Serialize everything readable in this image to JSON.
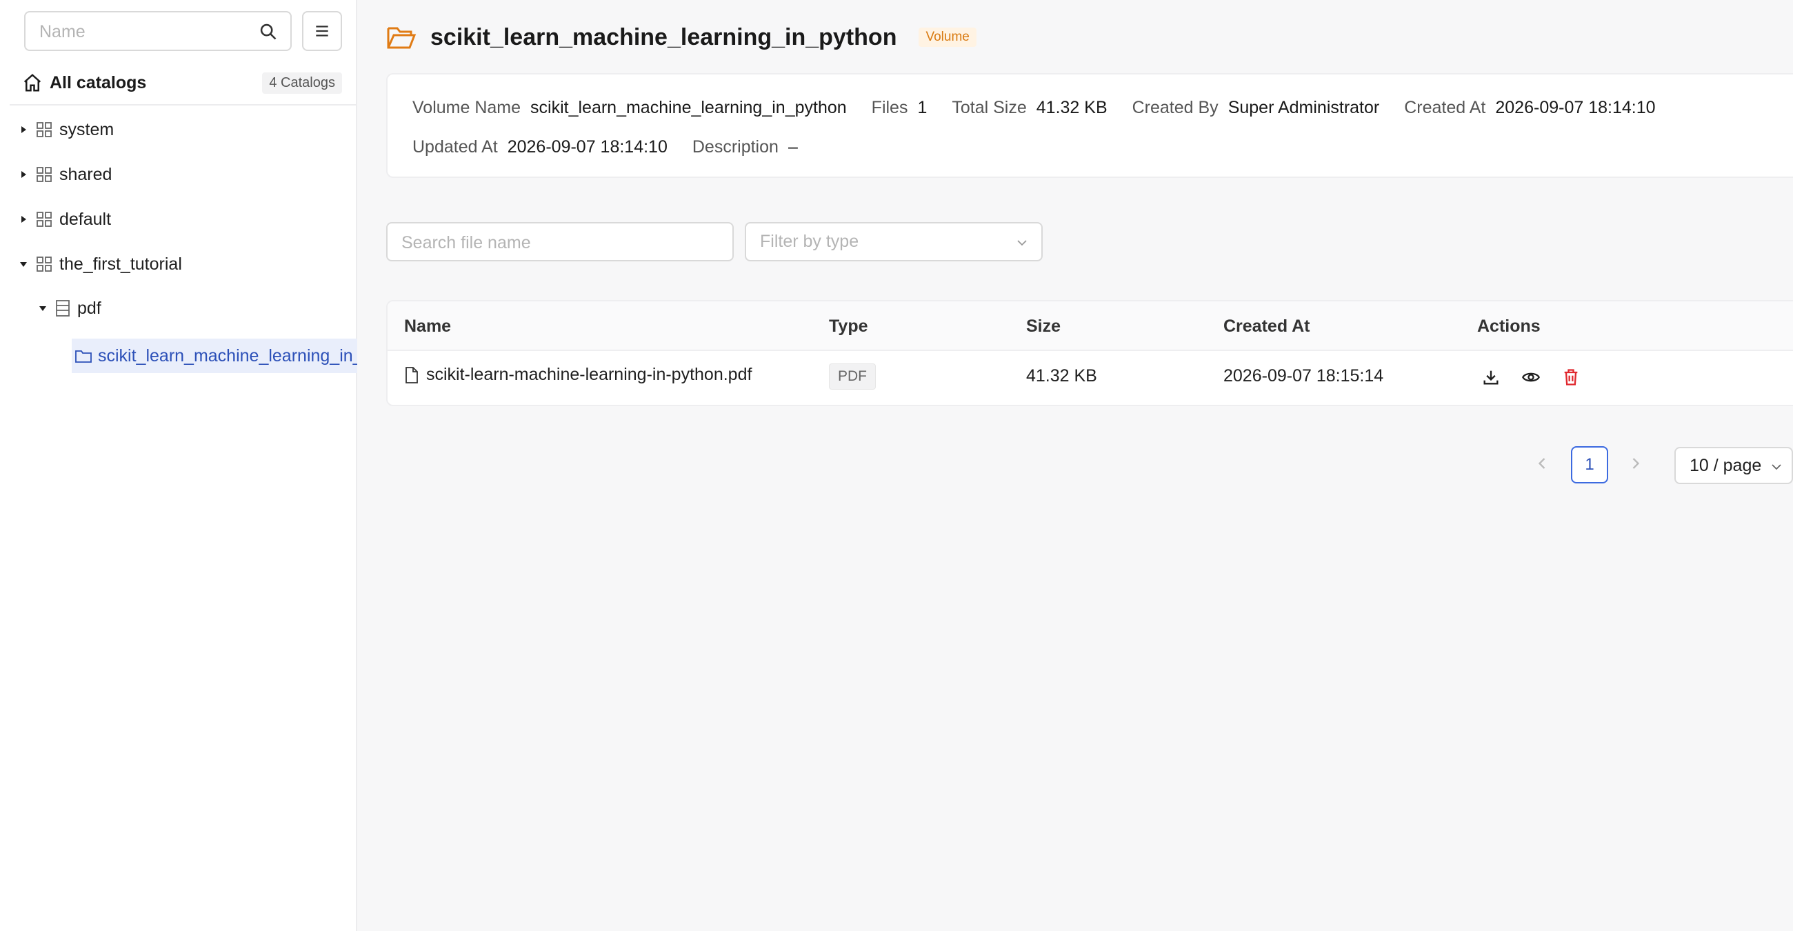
{
  "sidebar": {
    "search_placeholder": "Name",
    "all_catalogs_label": "All catalogs",
    "catalog_count": "4 Catalogs",
    "tree": [
      {
        "label": "system",
        "expanded": false
      },
      {
        "label": "shared",
        "expanded": false
      },
      {
        "label": "default",
        "expanded": false
      },
      {
        "label": "the_first_tutorial",
        "expanded": true
      }
    ],
    "schema": {
      "label": "pdf",
      "expanded": true
    },
    "selected_volume": "scikit_learn_machine_learning_in_python"
  },
  "header": {
    "title": "scikit_learn_machine_learning_in_python",
    "tag": "Volume"
  },
  "info": {
    "volume_name_key": "Volume Name",
    "volume_name": "scikit_learn_machine_learning_in_python",
    "files_key": "Files",
    "files": "1",
    "total_size_key": "Total Size",
    "total_size": "41.32 KB",
    "created_by_key": "Created By",
    "created_by": "Super Administrator",
    "created_at_key": "Created At",
    "created_at": "2026-09-07 18:14:10",
    "updated_at_key": "Updated At",
    "updated_at": "2026-09-07 18:14:10",
    "description_key": "Description",
    "description": "–"
  },
  "filters": {
    "search_placeholder": "Search file name",
    "type_placeholder": "Filter by type"
  },
  "table": {
    "columns": [
      "Name",
      "Type",
      "Size",
      "Created At",
      "Actions"
    ],
    "rows": [
      {
        "name": "scikit-learn-machine-learning-in-python.pdf",
        "type": "PDF",
        "size": "41.32 KB",
        "created_at": "2026-09-07 18:15:14"
      }
    ]
  },
  "pagination": {
    "current_page": "1",
    "page_size": "10 / page"
  },
  "colors": {
    "accent": "#2c50b8",
    "volume_icon": "#e07b14",
    "delete": "#e0282e"
  }
}
